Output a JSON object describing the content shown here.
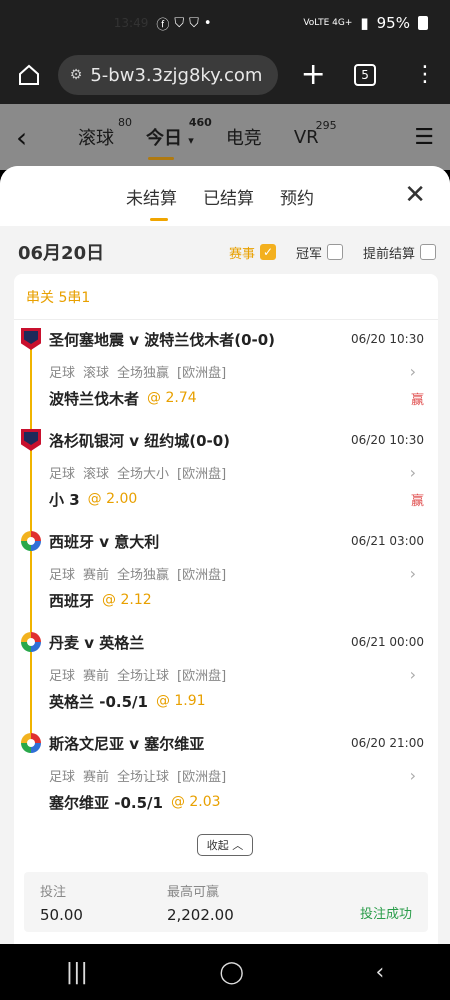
{
  "status": {
    "time": "13:49",
    "icons": [
      "facebook-icon",
      "shield-icon",
      "shield-icon",
      "dot-icon"
    ],
    "right": "95%",
    "net": "VoLTE 4G+"
  },
  "browser": {
    "url": "5-bw3.3zjg8ky.com",
    "tab_count": "5"
  },
  "nav": {
    "tabs": [
      {
        "label": "滚球",
        "count": "80"
      },
      {
        "label": "今日",
        "count": "460"
      },
      {
        "label": "电竞",
        "count": ""
      },
      {
        "label": "VR",
        "count": "295"
      }
    ]
  },
  "sheet": {
    "tabs": [
      "未结算",
      "已结算",
      "预约"
    ],
    "date": "06月20日",
    "options": [
      {
        "label": "赛事",
        "checked": true
      },
      {
        "label": "冠军",
        "checked": false
      },
      {
        "label": "提前结算",
        "checked": false
      }
    ],
    "parlay": "串关 5串1",
    "legs": [
      {
        "badge": "mls",
        "match": "圣何塞地震 v 波特兰伐木者(0-0)",
        "time": "06/20 10:30",
        "meta": [
          "足球",
          "滚球",
          "全场独赢",
          "[欧洲盘]"
        ],
        "pick": "波特兰伐木者",
        "odds": "@ 2.74",
        "result": "赢"
      },
      {
        "badge": "mls",
        "match": "洛杉矶银河 v 纽约城(0-0)",
        "time": "06/20 10:30",
        "meta": [
          "足球",
          "滚球",
          "全场大小",
          "[欧洲盘]"
        ],
        "pick": "小 3",
        "odds": "@ 2.00",
        "result": "赢"
      },
      {
        "badge": "euro",
        "match": "西班牙 v 意大利",
        "time": "06/21 03:00",
        "meta": [
          "足球",
          "赛前",
          "全场独赢",
          "[欧洲盘]"
        ],
        "pick": "西班牙",
        "odds": "@ 2.12",
        "result": ""
      },
      {
        "badge": "euro",
        "match": "丹麦 v 英格兰",
        "time": "06/21 00:00",
        "meta": [
          "足球",
          "赛前",
          "全场让球",
          "[欧洲盘]"
        ],
        "pick": "英格兰 -0.5/1",
        "odds": "@ 1.91",
        "result": ""
      },
      {
        "badge": "euro",
        "match": "斯洛文尼亚 v 塞尔维亚",
        "time": "06/20 21:00",
        "meta": [
          "足球",
          "赛前",
          "全场让球",
          "[欧洲盘]"
        ],
        "pick": "塞尔维亚 -0.5/1",
        "odds": "@ 2.03",
        "result": ""
      }
    ],
    "collapse": "收起",
    "summary": {
      "stake_label": "投注",
      "stake": "50.00",
      "max_label": "最高可赢",
      "max": "2,202.00",
      "status": "投注成功"
    }
  }
}
